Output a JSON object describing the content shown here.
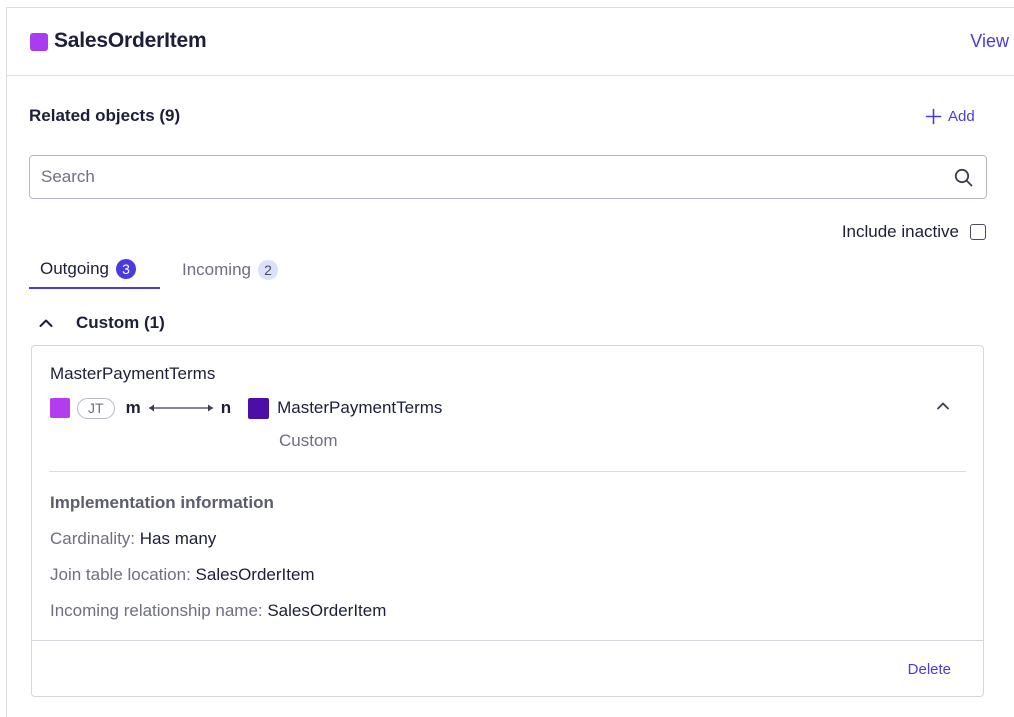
{
  "header": {
    "title": "SalesOrderItem",
    "view_label": "View",
    "type_color": "#a93bf0"
  },
  "related": {
    "title": "Related objects (9)",
    "add_label": "Add"
  },
  "search": {
    "placeholder": "Search",
    "value": ""
  },
  "filters": {
    "include_inactive_label": "Include inactive",
    "include_inactive_checked": false
  },
  "tabs": [
    {
      "label": "Outgoing",
      "count": "3",
      "active": true
    },
    {
      "label": "Incoming",
      "count": "2",
      "active": false
    }
  ],
  "group": {
    "label": "Custom (1)",
    "expanded": true
  },
  "relationship": {
    "name": "MasterPaymentTerms",
    "join_badge": "JT",
    "source_multiplicity": "m",
    "target_multiplicity": "n",
    "target_name": "MasterPaymentTerms",
    "target_type": "Custom",
    "source_color": "#b33bf0",
    "target_color": "#4b0fa8",
    "implementation": {
      "title": "Implementation information",
      "rows": [
        {
          "label": "Cardinality: ",
          "value": "Has many"
        },
        {
          "label": "Join table location: ",
          "value": "SalesOrderItem"
        },
        {
          "label": "Incoming relationship name: ",
          "value": "SalesOrderItem"
        }
      ]
    },
    "delete_label": "Delete"
  },
  "colors": {
    "accent": "#4a3bdf",
    "text_primary": "#1c1e3a",
    "text_secondary": "#6e6f80",
    "border": "#dcdce4"
  }
}
